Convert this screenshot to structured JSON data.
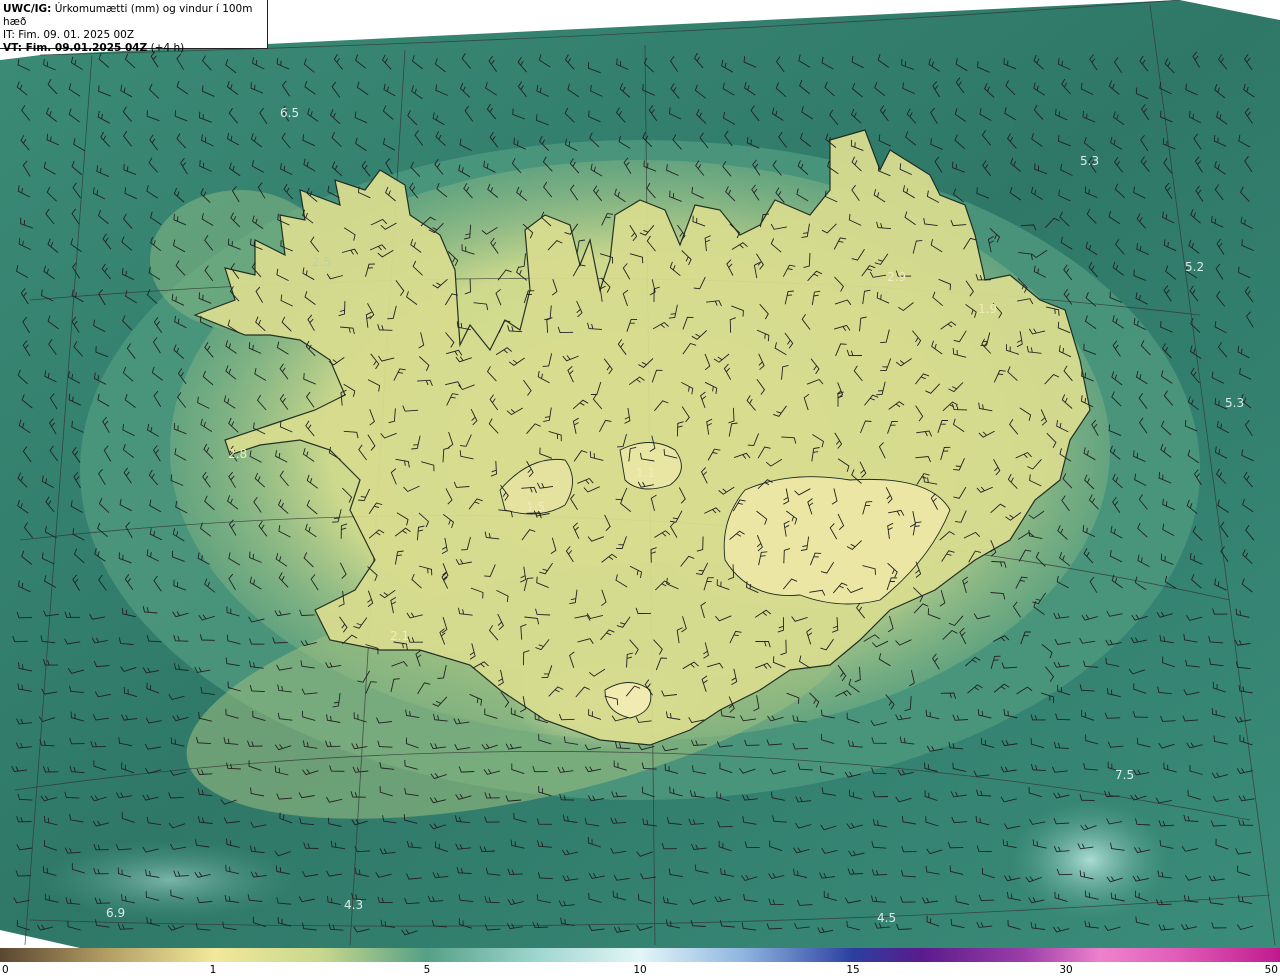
{
  "header": {
    "product": "UWC/IG:",
    "description": "Úrkomumætti (mm) og vindur í 100m hæð",
    "initial_time": "IT: Fim. 09. 01. 2025 00Z",
    "valid_label": "VT: Fim. 09.01.2025 04Z",
    "valid_offset": "(+4 h)"
  },
  "map_labels": [
    "6.5",
    "5.3",
    "5.2",
    "5.3",
    "7.5",
    "6.9",
    "4.3",
    "4.5",
    "2.5",
    "2.9",
    "1.9",
    "1.5",
    "1.1",
    "2.8",
    "2.1"
  ],
  "colorbar": {
    "ticks": [
      "0",
      "1",
      "5",
      "10",
      "15",
      "30",
      "50"
    ],
    "colors": [
      "#5a4730",
      "#f2e89a",
      "#55a085",
      "#e2f6f8",
      "#2b3fa0",
      "#ee82cc",
      "#c01a8c"
    ]
  },
  "colors": {
    "sea_field": "#2f7b6b",
    "land_field": "#d6d98a",
    "coast": "#1d2a20",
    "barb": "#222222"
  }
}
